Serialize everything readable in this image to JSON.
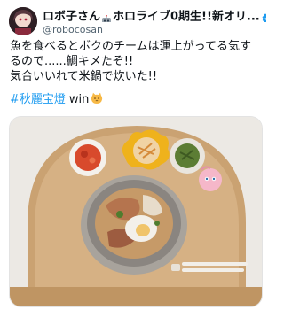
{
  "tweet": {
    "display_name": "ロボ子さん",
    "display_name_suffix": "ホロライブ0期生!!新オリ...",
    "handle": "@robocosan",
    "text_lines": [
      "魚を食べるとボクのチームは運上がってる気す",
      "るので......鯛キメたぞ!!",
      "気合いいれて米鍋で炊いた!!"
    ],
    "hashtag": "#秋麗宝燈",
    "hashtag_suffix": "win"
  },
  "icons": {
    "avatar": "avatar-image",
    "robot": "robot-emoji-icon",
    "verified": "verified-badge-icon",
    "cat": "cat-emoji-icon"
  },
  "colors": {
    "link": "#1d9bf0",
    "verified": "#1d9bf0",
    "secondary_text": "#536471"
  }
}
